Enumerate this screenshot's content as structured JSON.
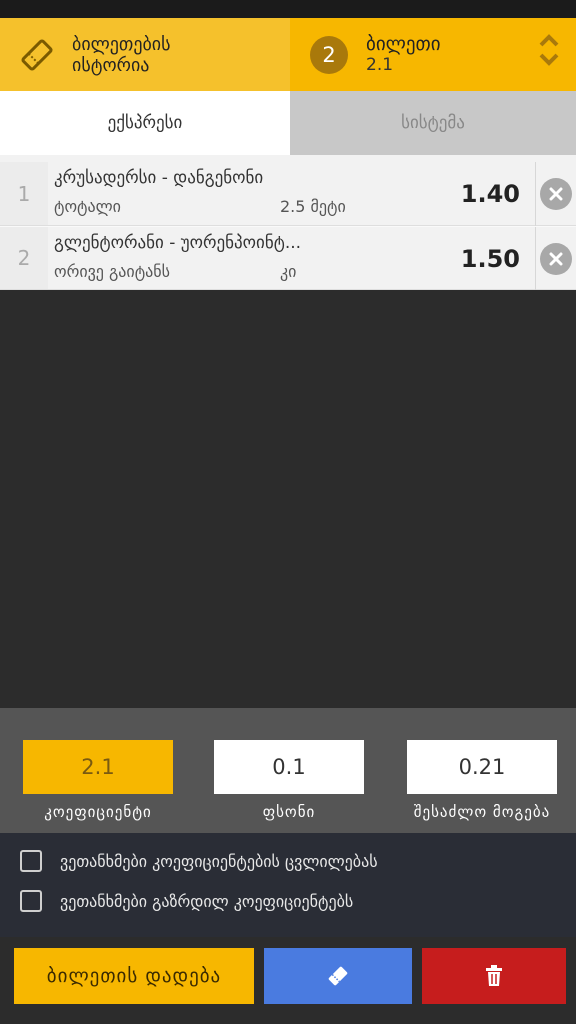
{
  "header": {
    "history_title": "ბილეთების\nისტორია",
    "bet_count": "2",
    "bet_title": "ბილეთი",
    "bet_odds": "2.1"
  },
  "tabs": [
    {
      "label": "ექსპრესი",
      "active": true
    },
    {
      "label": "სისტემა",
      "active": false
    }
  ],
  "selections": [
    {
      "index": "1",
      "match": "კრუსადერსი - დანგენონი",
      "market": "ტოტალი",
      "outcome": "2.5 მეტი",
      "odd": "1.40"
    },
    {
      "index": "2",
      "match": "გლენტორანი - უორენპოინტ...",
      "market": "ორივე გაიტანს",
      "outcome": "კი",
      "odd": "1.50"
    }
  ],
  "summary": {
    "odds_value": "2.1",
    "stake_value": "0.1",
    "win_value": "0.21",
    "odds_label": "კოეფიციენტი",
    "stake_label": "ფსონი",
    "win_label": "შესაძლო მოგება"
  },
  "options": [
    {
      "label": "ვეთანხმები კოეფიციენტების ცვლილებას",
      "checked": false
    },
    {
      "label": "ვეთანხმები გაზრდილ კოეფიციენტებს",
      "checked": false
    }
  ],
  "actions": {
    "place_label": "ბილეთის დადება"
  },
  "colors": {
    "accent_yellow": "#f7b700",
    "save_blue": "#4a7be0",
    "delete_red": "#c61d1d"
  }
}
